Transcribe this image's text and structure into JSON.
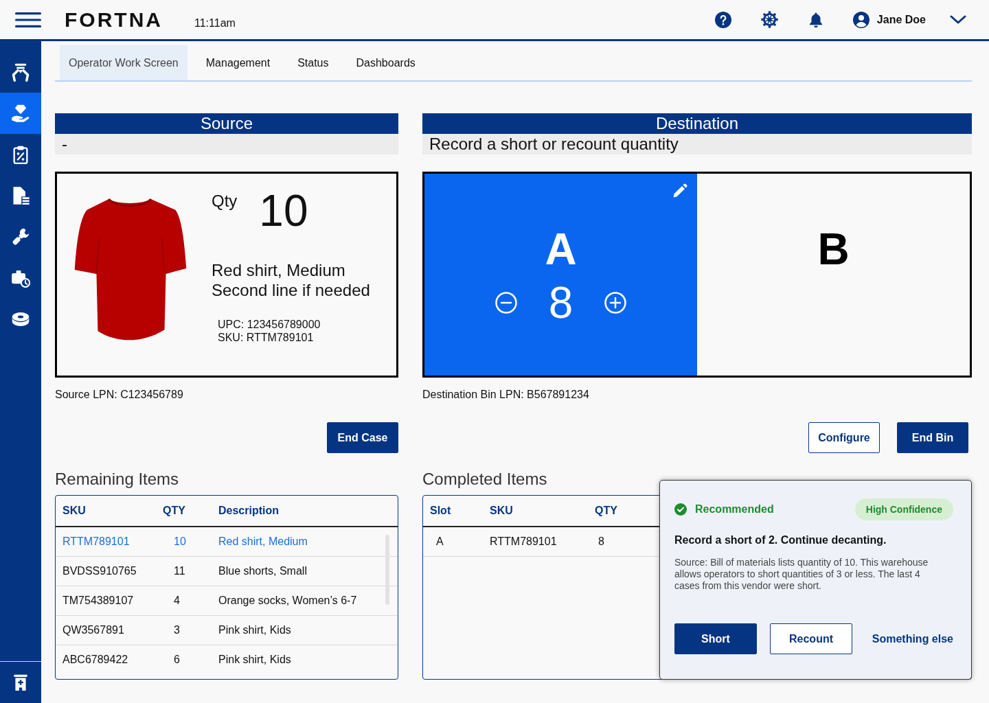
{
  "header": {
    "logo": "FORTNA",
    "time": "11:11am",
    "user_name": "Jane Doe"
  },
  "sidebar": {
    "items": [
      {
        "selected": false
      },
      {
        "selected": true
      },
      {
        "selected": false
      },
      {
        "selected": false
      },
      {
        "selected": false
      },
      {
        "selected": false
      },
      {
        "selected": false
      }
    ],
    "footer_item": {
      "selected": false
    }
  },
  "tabs": [
    {
      "label": "Operator Work Screen",
      "selected": true
    },
    {
      "label": "Management",
      "selected": false
    },
    {
      "label": "Status",
      "selected": false
    },
    {
      "label": "Dashboards",
      "selected": false
    }
  ],
  "source": {
    "title": "Source",
    "subtitle": "-",
    "product": {
      "qty_label": "Qty",
      "qty": "10",
      "name_lines": [
        "Red shirt, Medium",
        "Second line if needed"
      ],
      "upc": "UPC: 123456789000",
      "sku": "SKU: RTTM789101"
    },
    "lpn": "Source LPN: C123456789",
    "buttons": [
      {
        "label": "End Case",
        "kind": "primary"
      }
    ]
  },
  "destination": {
    "title": "Destination",
    "subtitle": "Record a short or recount quantity",
    "slots": [
      {
        "label": "A",
        "selected": true,
        "qty": "8"
      },
      {
        "label": "B",
        "selected": false
      }
    ],
    "lpn": "Destination Bin LPN: B567891234",
    "buttons": [
      {
        "label": "Configure",
        "kind": "outline"
      },
      {
        "label": "End Bin",
        "kind": "primary"
      }
    ]
  },
  "remaining_items": {
    "title": "Remaining Items",
    "columns": [
      "SKU",
      "QTY",
      "Description"
    ],
    "rows": [
      {
        "cells": [
          "RTTM789101",
          "10",
          "Red shirt, Medium"
        ],
        "selected": true
      },
      {
        "cells": [
          "BVDSS910765",
          "11",
          "Blue shorts, Small"
        ],
        "selected": false
      },
      {
        "cells": [
          "TM754389107",
          "4",
          "Orange socks, Women’s 6-7"
        ],
        "selected": false
      },
      {
        "cells": [
          "QW3567891",
          "3",
          "Pink shirt, Kids"
        ],
        "selected": false
      },
      {
        "cells": [
          "ABC6789422",
          "6",
          "Pink shirt, Kids"
        ],
        "selected": false
      }
    ]
  },
  "completed_items": {
    "title": "Completed Items",
    "columns": [
      "Slot",
      "SKU",
      "QTY"
    ],
    "rows": [
      {
        "cells": [
          "A",
          "RTTM789101",
          "8"
        ]
      }
    ]
  },
  "recommendation": {
    "status": "Recommended",
    "confidence": "High Confidence",
    "title": "Record a short of 2. Continue decanting.",
    "body": "Source: Bill of materials lists quantity of 10. This warehouse allows operators to short quantities of 3 or less. The last 4 cases from this vendor were short.",
    "buttons": [
      {
        "label": "Short",
        "kind": "primary"
      },
      {
        "label": "Recount",
        "kind": "outline"
      },
      {
        "label": "Something else",
        "kind": "link"
      }
    ]
  }
}
